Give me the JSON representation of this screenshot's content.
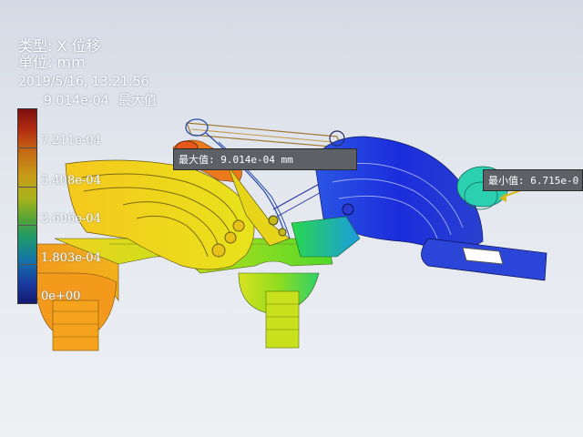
{
  "info": {
    "type_label": "类型: X 位移",
    "unit_label": "单位: mm",
    "timestamp": "2019/5/16, 13:21:56"
  },
  "legend": {
    "max_value": "9.014e-04",
    "max_suffix": "最大值",
    "ticks": [
      "7.211e-04",
      "5.408e-04",
      "3.606e-04",
      "1.803e-04",
      "0e+00"
    ],
    "colors": [
      "#7b1010",
      "#c56a14",
      "#a8b31c",
      "#1f9a6a",
      "#1473a8",
      "#141a70"
    ]
  },
  "callouts": {
    "max": "最大值: 9.014e-04 mm",
    "min": "最小值: 6.715e-0"
  }
}
